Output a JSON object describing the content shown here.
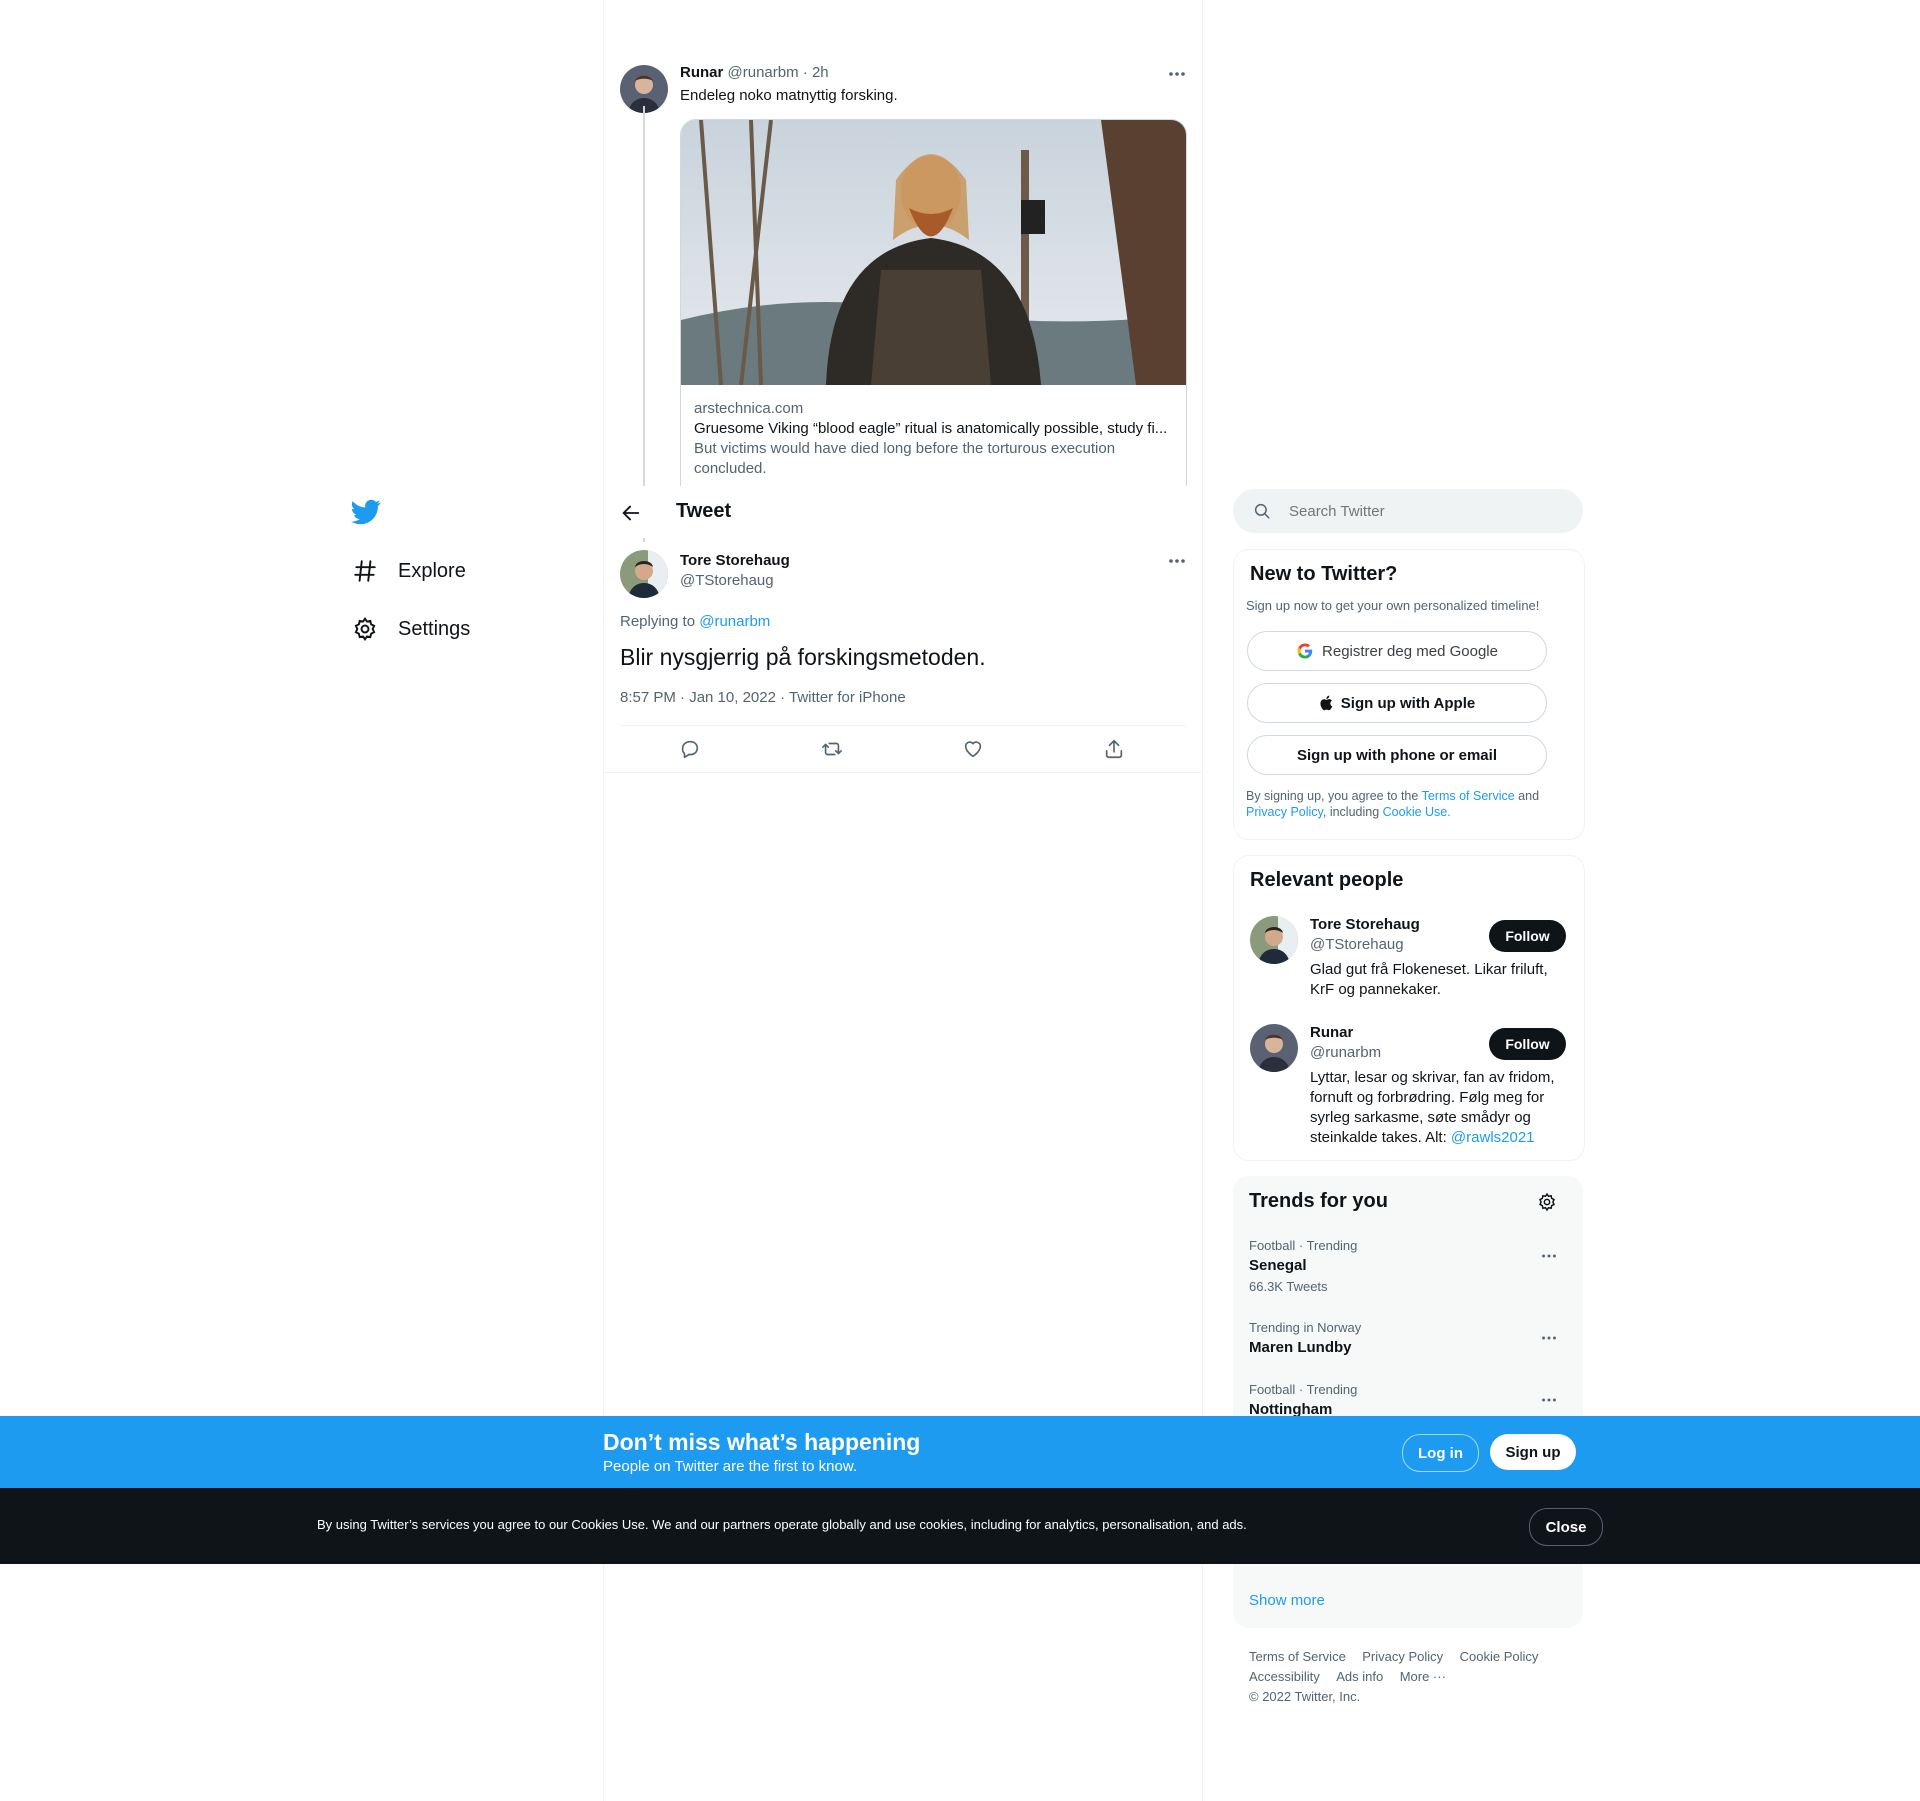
{
  "nav": {
    "explore": "Explore",
    "settings": "Settings"
  },
  "parent_tweet": {
    "name": "Runar",
    "handle": "@runarbm",
    "time": "· 2h",
    "text": "Endeleg noko matnyttig forsking.",
    "card": {
      "domain": "arstechnica.com",
      "title": "Gruesome Viking “blood eagle” ritual is anatomically possible, study fi...",
      "description": "But victims would have died long before the torturous execution concluded."
    }
  },
  "header": {
    "title": "Tweet"
  },
  "main_tweet": {
    "name": "Tore Storehaug",
    "handle": "@TStorehaug",
    "replying_prefix": "Replying to ",
    "replying_handle": "@runarbm",
    "text": "Blir nysgjerrig på forskingsmetoden.",
    "meta": "8:57 PM · Jan 10, 2022 · Twitter for iPhone"
  },
  "search": {
    "placeholder": "Search Twitter"
  },
  "new_to_twitter": {
    "title": "New to Twitter?",
    "subtitle": "Sign up now to get your own personalized timeline!",
    "google_label": "Registrer deg med Google",
    "apple_label": "Sign up with Apple",
    "phone_label": "Sign up with phone or email",
    "legal_prefix": "By signing up, you agree to the ",
    "terms_link": "Terms of Service",
    "legal_and": " and",
    "privacy_link": "Privacy Policy",
    "legal_including": ", including ",
    "cookie_link": "Cookie Use."
  },
  "relevant_people": {
    "title": "Relevant people",
    "follow_label": "Follow",
    "people": [
      {
        "name": "Tore Storehaug",
        "handle": "@TStorehaug",
        "bio": "Glad gut frå Flokeneset. Likar friluft, KrF og pannekaker."
      },
      {
        "name": "Runar",
        "handle": "@runarbm",
        "bio": "Lyttar, lesar og skrivar, fan av fridom, fornuft og forbrødring. Følg meg for syrleg sarkasme, søte smådyr og steinkalde takes. Alt: ",
        "bio_link": "@rawls2021"
      }
    ]
  },
  "trends": {
    "title": "Trends for you",
    "items": [
      {
        "meta": "Football · Trending",
        "name": "Senegal",
        "count": "66.3K Tweets"
      },
      {
        "meta": "Trending in Norway",
        "name": "Maren Lundby"
      },
      {
        "meta": "Football · Trending",
        "name": "Nottingham"
      }
    ],
    "show_more": "Show more"
  },
  "footer": {
    "links_row1": [
      "Terms of Service",
      "Privacy Policy",
      "Cookie Policy"
    ],
    "links_row2": [
      "Accessibility",
      "Ads info",
      "More ···"
    ],
    "copyright": "© 2022 Twitter, Inc."
  },
  "signup_banner": {
    "title": "Don’t miss what’s happening",
    "subtitle": "People on Twitter are the first to know.",
    "login_label": "Log in",
    "signup_label": "Sign up"
  },
  "cookie_banner": {
    "text": "By using Twitter’s services you agree to our Cookies Use. We and our partners operate globally and use cookies, including for analytics, personalisation, and ads.",
    "close_label": "Close"
  },
  "colors": {
    "accent": "#1d9bf0",
    "dark": "#0f1419",
    "muted": "#536471",
    "border": "#eff3f4"
  }
}
